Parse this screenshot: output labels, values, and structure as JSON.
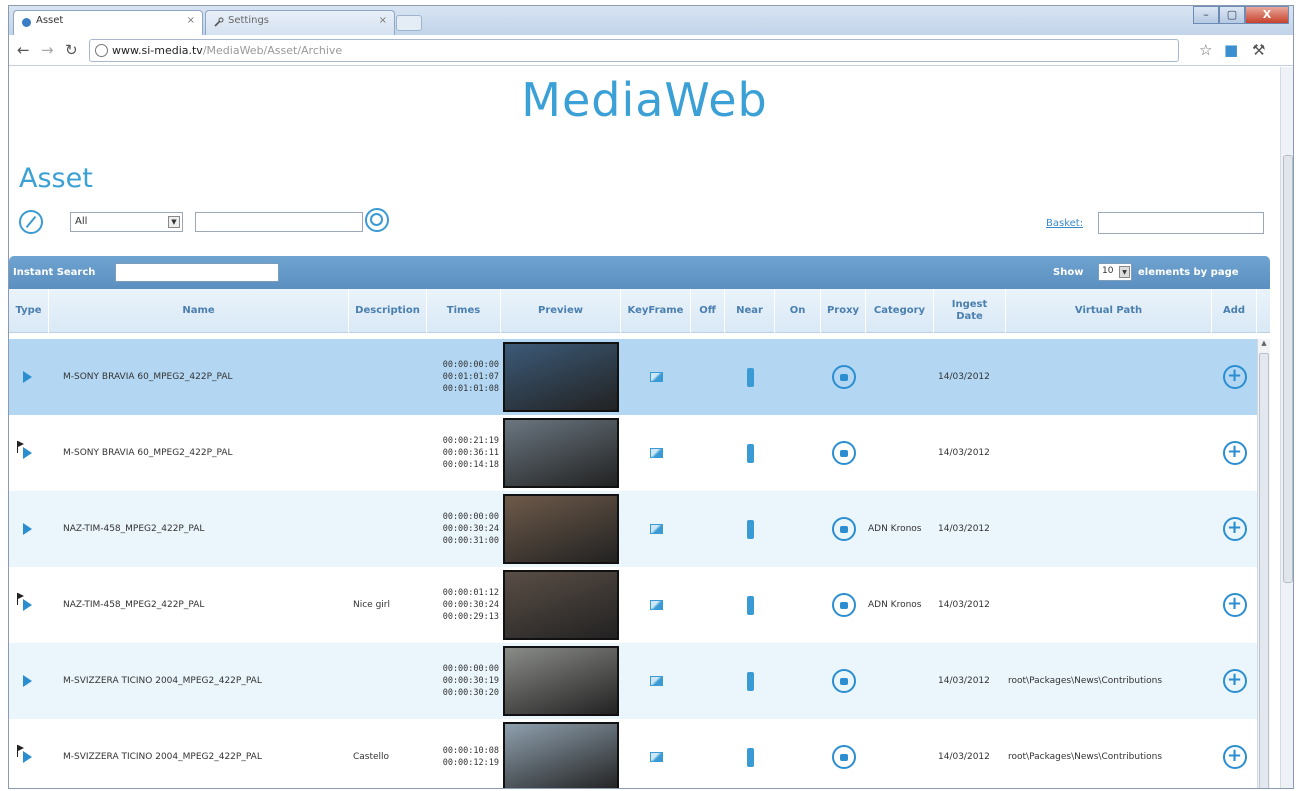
{
  "browser": {
    "tabs": [
      {
        "label": "Asset",
        "active": true
      },
      {
        "label": "Settings",
        "active": false
      }
    ],
    "url_host": "www.si-media.tv",
    "url_path": "/MediaWeb/Asset/Archive",
    "window_controls": {
      "minimize": "–",
      "maximize": "▢",
      "close": "X"
    }
  },
  "page": {
    "site_title": "MediaWeb",
    "section_title": "Asset",
    "filter_select_value": "All",
    "basket_label": "Basket:"
  },
  "grid": {
    "instant_search_label": "Instant Search",
    "show_label": "Show",
    "page_size": "10",
    "elements_label": "elements by page",
    "columns": [
      "Type",
      "Name",
      "Description",
      "Times",
      "Preview",
      "KeyFrame",
      "Off",
      "Near",
      "On",
      "Proxy",
      "Category",
      "Ingest Date",
      "Virtual Path",
      "Add"
    ],
    "rows": [
      {
        "flag": false,
        "name": "M-SONY BRAVIA 60_MPEG2_422P_PAL",
        "description": "",
        "time_in": "00:00:00:00",
        "time_out": "00:01:01:07",
        "time_dur": "00:01:01:08",
        "category": "",
        "ingest_date": "14/03/2012",
        "virtual_path": "",
        "thumb_color": "#3c5a78"
      },
      {
        "flag": true,
        "name": "M-SONY BRAVIA 60_MPEG2_422P_PAL",
        "description": "",
        "time_in": "00:00:21:19",
        "time_out": "00:00:36:11",
        "time_dur": "00:00:14:18",
        "category": "",
        "ingest_date": "14/03/2012",
        "virtual_path": "",
        "thumb_color": "#6a7680"
      },
      {
        "flag": false,
        "name": "NAZ-TIM-458_MPEG2_422P_PAL",
        "description": "",
        "time_in": "00:00:00:00",
        "time_out": "00:00:30:24",
        "time_dur": "00:00:31:00",
        "category": "ADN Kronos",
        "ingest_date": "14/03/2012",
        "virtual_path": "",
        "thumb_color": "#6e5a4a"
      },
      {
        "flag": true,
        "name": "NAZ-TIM-458_MPEG2_422P_PAL",
        "description": "Nice girl",
        "time_in": "00:00:01:12",
        "time_out": "00:00:30:24",
        "time_dur": "00:00:29:13",
        "category": "ADN Kronos",
        "ingest_date": "14/03/2012",
        "virtual_path": "",
        "thumb_color": "#5a4e46"
      },
      {
        "flag": false,
        "name": "M-SVIZZERA TICINO 2004_MPEG2_422P_PAL",
        "description": "",
        "time_in": "00:00:00:00",
        "time_out": "00:00:30:19",
        "time_dur": "00:00:30:20",
        "category": "",
        "ingest_date": "14/03/2012",
        "virtual_path": "root\\Packages\\News\\Contributions",
        "thumb_color": "#8a8c88"
      },
      {
        "flag": true,
        "name": "M-SVIZZERA TICINO 2004_MPEG2_422P_PAL",
        "description": "Castello",
        "time_in": "00:00:10:08",
        "time_out": "00:00:12:19",
        "time_dur": "",
        "category": "",
        "ingest_date": "14/03/2012",
        "virtual_path": "root\\Packages\\News\\Contributions",
        "thumb_color": "#8fa0ae"
      }
    ]
  },
  "colors": {
    "accent": "#3aa0d6",
    "grid_bar": "#5a8fc0",
    "selected_row": "#b3d7f3",
    "alt_row": "#eaf5fc"
  }
}
